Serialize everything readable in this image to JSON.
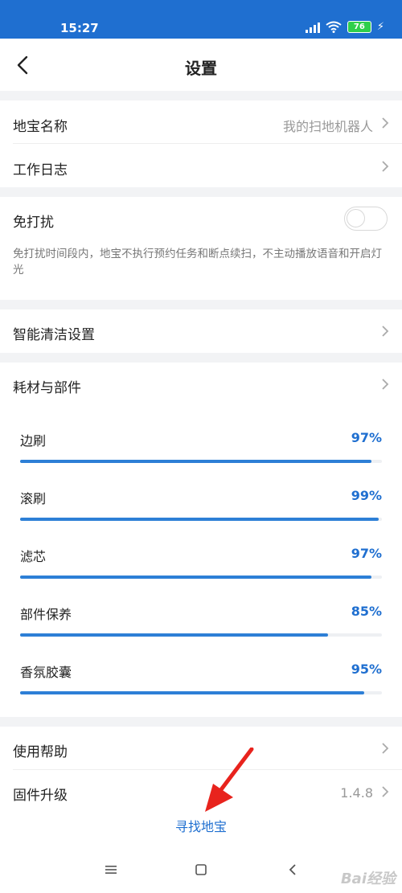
{
  "status_bar": {
    "time": "15:27",
    "battery": "76",
    "icons": [
      "signal-icon",
      "wifi-icon",
      "battery-icon",
      "charging-icon"
    ]
  },
  "header": {
    "title": "设置",
    "back_icon": "chevron-left-icon"
  },
  "settings": {
    "name_label": "地宝名称",
    "name_value": "我的扫地机器人",
    "log_label": "工作日志",
    "dnd_label": "免打扰",
    "dnd_enabled": false,
    "dnd_description": "免打扰时间段内，地宝不执行预约任务和断点续扫，不主动播放语音和开启灯光",
    "smart_clean_label": "智能清洁设置",
    "consumables_label": "耗材与部件",
    "help_label": "使用帮助",
    "firmware_label": "固件升级",
    "firmware_version": "1.4.8"
  },
  "parts": [
    {
      "name": "边刷",
      "percent_label": "97%",
      "percent": 97
    },
    {
      "name": "滚刷",
      "percent_label": "99%",
      "percent": 99
    },
    {
      "name": "滤芯",
      "percent_label": "97%",
      "percent": 97
    },
    {
      "name": "部件保养",
      "percent_label": "85%",
      "percent": 85
    },
    {
      "name": "香氛胶囊",
      "percent_label": "95%",
      "percent": 95
    }
  ],
  "find_button": "寻找地宝",
  "nav": {
    "menu_icon": "menu-icon",
    "home_icon": "home-icon",
    "back_icon": "back-icon"
  },
  "watermark": "Bai经验",
  "colors": {
    "accent": "#1f6fd0",
    "progress": "#2d7fd6",
    "status_bar": "#1f6fd0",
    "battery": "#2fcf4b"
  }
}
